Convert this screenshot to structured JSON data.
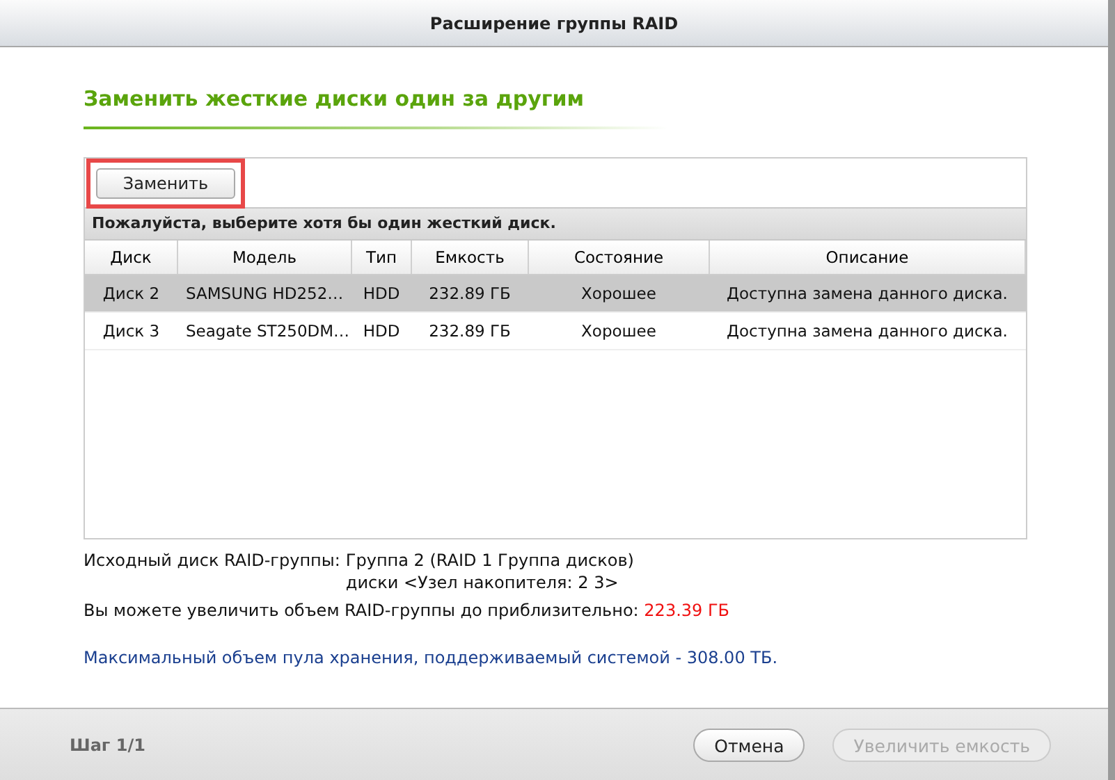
{
  "window": {
    "title": "Расширение группы RAID"
  },
  "heading": "Заменить жесткие диски один за другим",
  "toolbar": {
    "button": {
      "label": "Заменить",
      "highlighted": true
    }
  },
  "table": {
    "hint": "Пожалуйста, выберите хотя бы один жесткий диск.",
    "columns": [
      "Диск",
      "Модель",
      "Тип",
      "Емкость",
      "Состояние",
      "Описание"
    ],
    "rows": [
      {
        "cells": [
          "Диск 2",
          "SAMSUNG HD252…",
          "HDD",
          "232.89 ГБ",
          "Хорошее",
          "Доступна замена данного диска."
        ],
        "selected": true
      },
      {
        "cells": [
          "Диск 3",
          "Seagate ST250DM…",
          "HDD",
          "232.89 ГБ",
          "Хорошее",
          "Доступна замена данного диска."
        ],
        "selected": false
      }
    ]
  },
  "info": {
    "source_label": "Исходный диск RAID-группы:",
    "source_value": "Группа 2 (RAID 1 Группа дисков)",
    "source_disks": "диски <Узел накопителя: 2 3>",
    "expand_label": "Вы можете увеличить объем RAID-группы до приблизительно:",
    "expand_value": "223.39 ГБ",
    "max_note": "Максимальный объем пула хранения, поддерживаемый системой - 308.00 ТБ."
  },
  "footer": {
    "step": "Шаг 1/1",
    "buttons": [
      {
        "label": "Отмена",
        "disabled": false
      },
      {
        "label": "Увеличить емкость",
        "disabled": true
      }
    ]
  }
}
